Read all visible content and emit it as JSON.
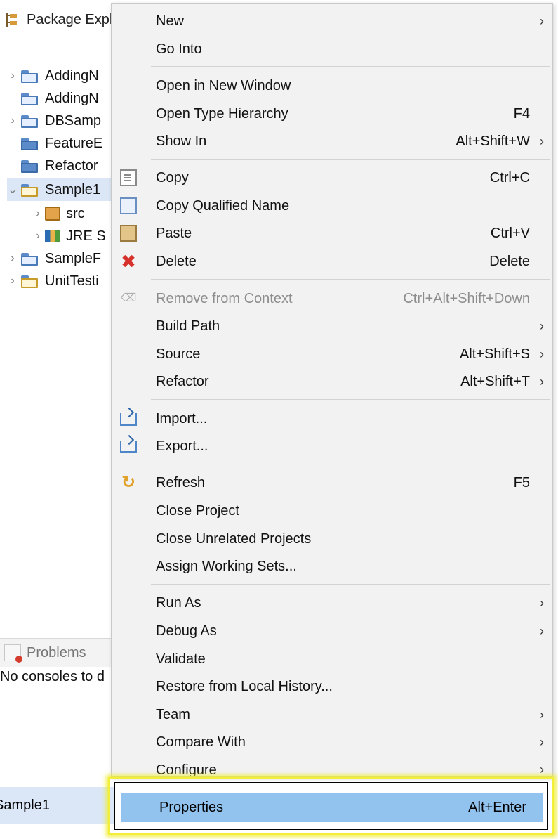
{
  "explorer": {
    "title": "Package Expl",
    "tree": [
      {
        "label": "AddingN",
        "chevron": "›",
        "icon": "project-open-folder"
      },
      {
        "label": "AddingN",
        "chevron": "",
        "icon": "project-open-folder"
      },
      {
        "label": "DBSamp",
        "chevron": "›",
        "icon": "project-open-folder"
      },
      {
        "label": "FeatureE",
        "chevron": "",
        "icon": "closed-folder"
      },
      {
        "label": "Refactor",
        "chevron": "",
        "icon": "closed-folder"
      },
      {
        "label": "Sample1",
        "chevron": "⌄",
        "icon": "java-project-folder"
      },
      {
        "label": "src",
        "chevron": "›",
        "icon": "package-icon"
      },
      {
        "label": "JRE S",
        "chevron": "›",
        "icon": "library-icon"
      },
      {
        "label": "SampleF",
        "chevron": "›",
        "icon": "project-open-folder"
      },
      {
        "label": "UnitTesti",
        "chevron": "›",
        "icon": "java-project-folder"
      }
    ],
    "problems_tab": "Problems",
    "console_message": "No consoles to d",
    "status_selection": "Sample1"
  },
  "menu": {
    "items": [
      {
        "label": "New",
        "shortcut": "",
        "arrow": "›",
        "icon": ""
      },
      {
        "label": "Go Into",
        "shortcut": "",
        "arrow": "",
        "icon": ""
      },
      {
        "label": "Open in New Window",
        "shortcut": "",
        "arrow": "",
        "icon": ""
      },
      {
        "label": "Open Type Hierarchy",
        "shortcut": "F4",
        "arrow": "",
        "icon": ""
      },
      {
        "label": "Show In",
        "shortcut": "Alt+Shift+W",
        "arrow": "›",
        "icon": ""
      },
      {
        "label": "Copy",
        "shortcut": "Ctrl+C",
        "arrow": "",
        "icon": "copy-icon"
      },
      {
        "label": "Copy Qualified Name",
        "shortcut": "",
        "arrow": "",
        "icon": "copy-qualified-name-icon"
      },
      {
        "label": "Paste",
        "shortcut": "Ctrl+V",
        "arrow": "",
        "icon": "paste-icon"
      },
      {
        "label": "Delete",
        "shortcut": "Delete",
        "arrow": "",
        "icon": "delete-icon"
      },
      {
        "label": "Remove from Context",
        "shortcut": "Ctrl+Alt+Shift+Down",
        "arrow": "",
        "icon": "remove-from-context-icon",
        "disabled": true
      },
      {
        "label": "Build Path",
        "shortcut": "",
        "arrow": "›",
        "icon": ""
      },
      {
        "label": "Source",
        "shortcut": "Alt+Shift+S",
        "arrow": "›",
        "icon": ""
      },
      {
        "label": "Refactor",
        "shortcut": "Alt+Shift+T",
        "arrow": "›",
        "icon": ""
      },
      {
        "label": "Import...",
        "shortcut": "",
        "arrow": "",
        "icon": "import-icon"
      },
      {
        "label": "Export...",
        "shortcut": "",
        "arrow": "",
        "icon": "export-icon"
      },
      {
        "label": "Refresh",
        "shortcut": "F5",
        "arrow": "",
        "icon": "refresh-icon"
      },
      {
        "label": "Close Project",
        "shortcut": "",
        "arrow": "",
        "icon": ""
      },
      {
        "label": "Close Unrelated Projects",
        "shortcut": "",
        "arrow": "",
        "icon": ""
      },
      {
        "label": "Assign Working Sets...",
        "shortcut": "",
        "arrow": "",
        "icon": ""
      },
      {
        "label": "Run As",
        "shortcut": "",
        "arrow": "›",
        "icon": ""
      },
      {
        "label": "Debug As",
        "shortcut": "",
        "arrow": "›",
        "icon": ""
      },
      {
        "label": "Validate",
        "shortcut": "",
        "arrow": "",
        "icon": ""
      },
      {
        "label": "Restore from Local History...",
        "shortcut": "",
        "arrow": "",
        "icon": ""
      },
      {
        "label": "Team",
        "shortcut": "",
        "arrow": "›",
        "icon": ""
      },
      {
        "label": "Compare With",
        "shortcut": "",
        "arrow": "›",
        "icon": ""
      },
      {
        "label": "Configure",
        "shortcut": "",
        "arrow": "›",
        "icon": ""
      }
    ],
    "properties": {
      "label": "Properties",
      "shortcut": "Alt+Enter"
    }
  },
  "colors": {
    "menu_background": "#f2f2f2",
    "selection_blue": "#92c3ee",
    "highlight_yellow": "#f2ef3a",
    "disabled_text": "#8d8d8d",
    "delete_red": "#d6312a"
  }
}
